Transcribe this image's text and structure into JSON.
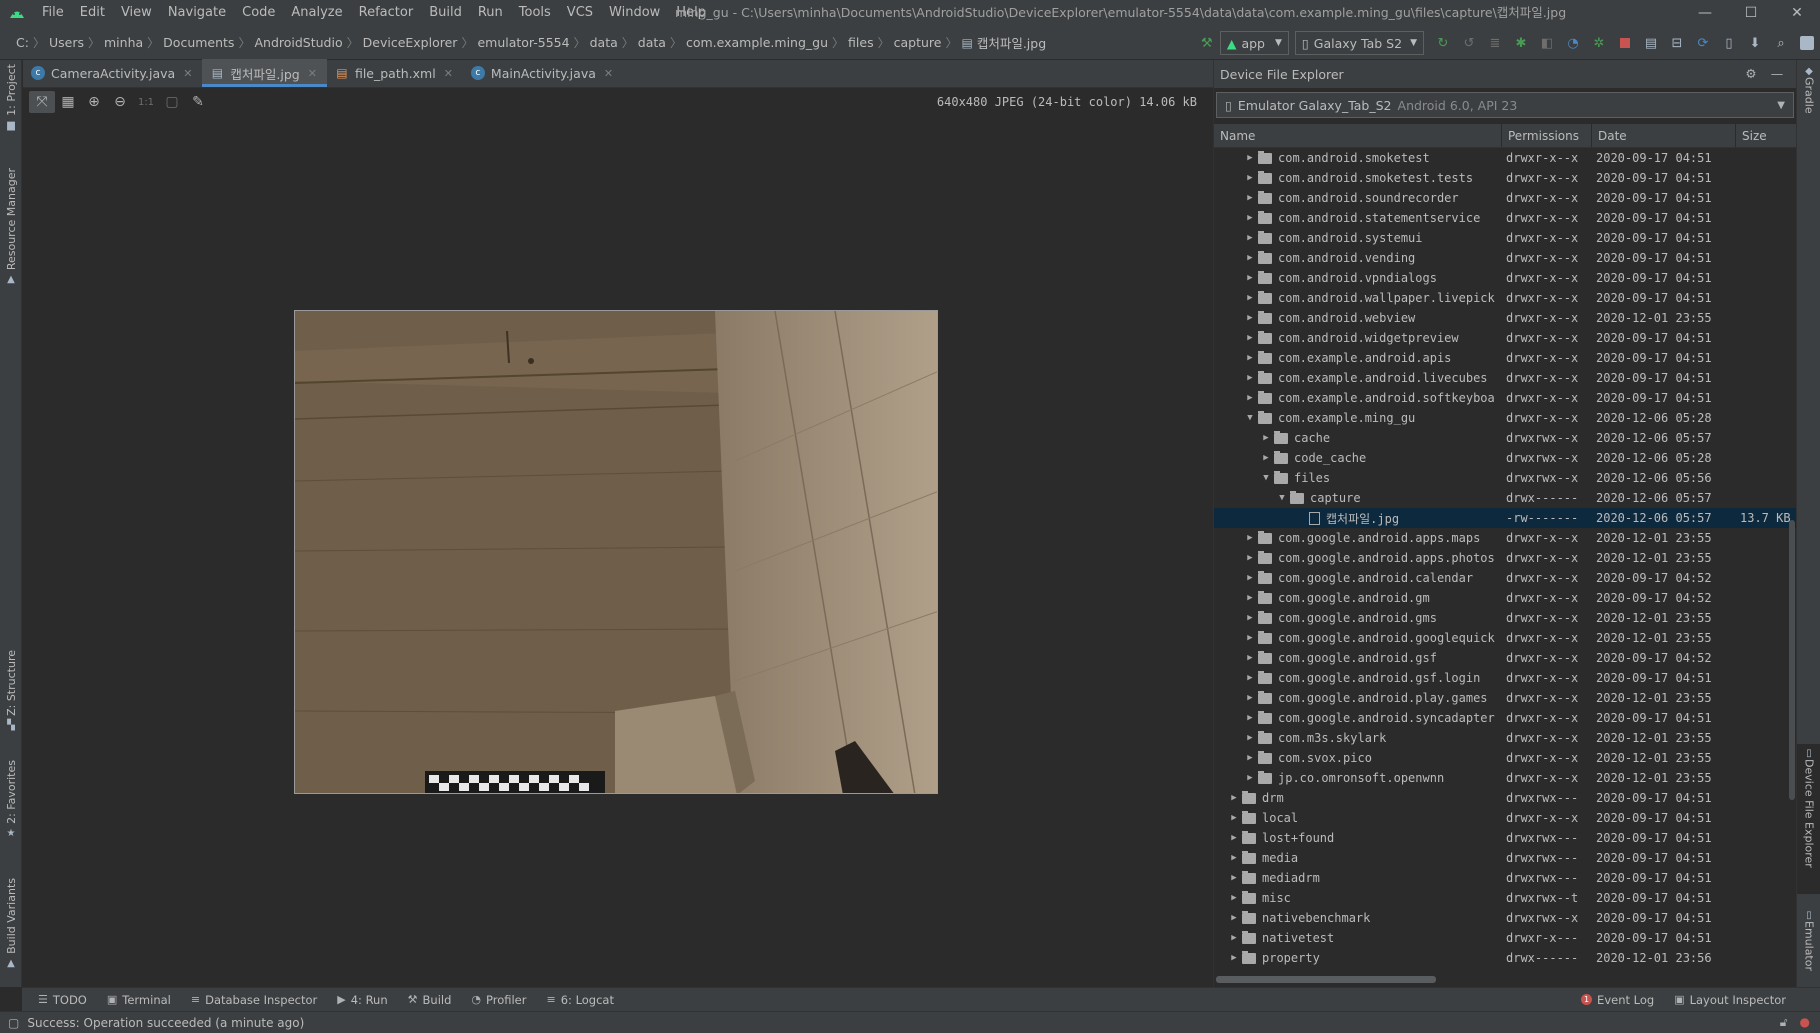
{
  "window": {
    "title": "ming_gu - C:\\Users\\minha\\Documents\\AndroidStudio\\DeviceExplorer\\emulator-5554\\data\\data\\com.example.ming_gu\\files\\capture\\캡처파일.jpg",
    "minimize": "—",
    "maximize": "☐",
    "close": "✕"
  },
  "menu": [
    "File",
    "Edit",
    "View",
    "Navigate",
    "Code",
    "Analyze",
    "Refactor",
    "Build",
    "Run",
    "Tools",
    "VCS",
    "Window",
    "Help"
  ],
  "breadcrumb": [
    "C:",
    "Users",
    "minha",
    "Documents",
    "AndroidStudio",
    "DeviceExplorer",
    "emulator-5554",
    "data",
    "data",
    "com.example.ming_gu",
    "files",
    "capture",
    "캡처파일.jpg"
  ],
  "toolbar": {
    "run_config": "app",
    "device": "Galaxy Tab S2"
  },
  "left_tools": [
    "1: Project",
    "Resource Manager",
    "Z: Structure",
    "2: Favorites",
    "Build Variants"
  ],
  "right_tools": [
    "Gradle",
    "Device File Explorer",
    "Emulator"
  ],
  "tabs": [
    {
      "label": "CameraActivity.java",
      "icon": "C",
      "active": false
    },
    {
      "label": "캡처파일.jpg",
      "icon": "img",
      "active": true
    },
    {
      "label": "file_path.xml",
      "icon": "xml",
      "active": false
    },
    {
      "label": "MainActivity.java",
      "icon": "C",
      "active": false
    }
  ],
  "image_viewer": {
    "info": "640x480 JPEG (24-bit color) 14.06 kB",
    "zoom_1to1": "1:1"
  },
  "device_explorer": {
    "title": "Device File Explorer",
    "device_name": "Emulator Galaxy_Tab_S2",
    "device_sub": "Android 6.0, API 23",
    "columns": [
      "Name",
      "Permissions",
      "Date",
      "Size"
    ],
    "rows": [
      {
        "name": "com.android.smoketest",
        "perm": "drwxr-x--x",
        "date": "2020-09-17 04:51",
        "size": "",
        "level": 2,
        "type": "folder",
        "state": "collapsed"
      },
      {
        "name": "com.android.smoketest.tests",
        "perm": "drwxr-x--x",
        "date": "2020-09-17 04:51",
        "size": "",
        "level": 2,
        "type": "folder",
        "state": "collapsed"
      },
      {
        "name": "com.android.soundrecorder",
        "perm": "drwxr-x--x",
        "date": "2020-09-17 04:51",
        "size": "",
        "level": 2,
        "type": "folder",
        "state": "collapsed"
      },
      {
        "name": "com.android.statementservice",
        "perm": "drwxr-x--x",
        "date": "2020-09-17 04:51",
        "size": "",
        "level": 2,
        "type": "folder",
        "state": "collapsed"
      },
      {
        "name": "com.android.systemui",
        "perm": "drwxr-x--x",
        "date": "2020-09-17 04:51",
        "size": "",
        "level": 2,
        "type": "folder",
        "state": "collapsed"
      },
      {
        "name": "com.android.vending",
        "perm": "drwxr-x--x",
        "date": "2020-09-17 04:51",
        "size": "",
        "level": 2,
        "type": "folder",
        "state": "collapsed"
      },
      {
        "name": "com.android.vpndialogs",
        "perm": "drwxr-x--x",
        "date": "2020-09-17 04:51",
        "size": "",
        "level": 2,
        "type": "folder",
        "state": "collapsed"
      },
      {
        "name": "com.android.wallpaper.livepick",
        "perm": "drwxr-x--x",
        "date": "2020-09-17 04:51",
        "size": "",
        "level": 2,
        "type": "folder",
        "state": "collapsed"
      },
      {
        "name": "com.android.webview",
        "perm": "drwxr-x--x",
        "date": "2020-12-01 23:55",
        "size": "",
        "level": 2,
        "type": "folder",
        "state": "collapsed"
      },
      {
        "name": "com.android.widgetpreview",
        "perm": "drwxr-x--x",
        "date": "2020-09-17 04:51",
        "size": "",
        "level": 2,
        "type": "folder",
        "state": "collapsed"
      },
      {
        "name": "com.example.android.apis",
        "perm": "drwxr-x--x",
        "date": "2020-09-17 04:51",
        "size": "",
        "level": 2,
        "type": "folder",
        "state": "collapsed"
      },
      {
        "name": "com.example.android.livecubes",
        "perm": "drwxr-x--x",
        "date": "2020-09-17 04:51",
        "size": "",
        "level": 2,
        "type": "folder",
        "state": "collapsed"
      },
      {
        "name": "com.example.android.softkeyboa",
        "perm": "drwxr-x--x",
        "date": "2020-09-17 04:51",
        "size": "",
        "level": 2,
        "type": "folder",
        "state": "collapsed"
      },
      {
        "name": "com.example.ming_gu",
        "perm": "drwxr-x--x",
        "date": "2020-12-06 05:28",
        "size": "",
        "level": 2,
        "type": "folder",
        "state": "expanded"
      },
      {
        "name": "cache",
        "perm": "drwxrwx--x",
        "date": "2020-12-06 05:57",
        "size": "",
        "level": 3,
        "type": "folder",
        "state": "collapsed"
      },
      {
        "name": "code_cache",
        "perm": "drwxrwx--x",
        "date": "2020-12-06 05:28",
        "size": "",
        "level": 3,
        "type": "folder",
        "state": "collapsed"
      },
      {
        "name": "files",
        "perm": "drwxrwx--x",
        "date": "2020-12-06 05:56",
        "size": "",
        "level": 3,
        "type": "folder",
        "state": "expanded"
      },
      {
        "name": "capture",
        "perm": "drwx------",
        "date": "2020-12-06 05:57",
        "size": "",
        "level": 4,
        "type": "folder",
        "state": "expanded"
      },
      {
        "name": "캡처파일.jpg",
        "perm": "-rw-------",
        "date": "2020-12-06 05:57",
        "size": "13.7 KB",
        "level": 5,
        "type": "file",
        "state": "none",
        "selected": true
      },
      {
        "name": "com.google.android.apps.maps",
        "perm": "drwxr-x--x",
        "date": "2020-12-01 23:55",
        "size": "",
        "level": 2,
        "type": "folder",
        "state": "collapsed"
      },
      {
        "name": "com.google.android.apps.photos",
        "perm": "drwxr-x--x",
        "date": "2020-12-01 23:55",
        "size": "",
        "level": 2,
        "type": "folder",
        "state": "collapsed"
      },
      {
        "name": "com.google.android.calendar",
        "perm": "drwxr-x--x",
        "date": "2020-09-17 04:52",
        "size": "",
        "level": 2,
        "type": "folder",
        "state": "collapsed"
      },
      {
        "name": "com.google.android.gm",
        "perm": "drwxr-x--x",
        "date": "2020-09-17 04:52",
        "size": "",
        "level": 2,
        "type": "folder",
        "state": "collapsed"
      },
      {
        "name": "com.google.android.gms",
        "perm": "drwxr-x--x",
        "date": "2020-12-01 23:55",
        "size": "",
        "level": 2,
        "type": "folder",
        "state": "collapsed"
      },
      {
        "name": "com.google.android.googlequick",
        "perm": "drwxr-x--x",
        "date": "2020-12-01 23:55",
        "size": "",
        "level": 2,
        "type": "folder",
        "state": "collapsed"
      },
      {
        "name": "com.google.android.gsf",
        "perm": "drwxr-x--x",
        "date": "2020-09-17 04:52",
        "size": "",
        "level": 2,
        "type": "folder",
        "state": "collapsed"
      },
      {
        "name": "com.google.android.gsf.login",
        "perm": "drwxr-x--x",
        "date": "2020-09-17 04:51",
        "size": "",
        "level": 2,
        "type": "folder",
        "state": "collapsed"
      },
      {
        "name": "com.google.android.play.games",
        "perm": "drwxr-x--x",
        "date": "2020-12-01 23:55",
        "size": "",
        "level": 2,
        "type": "folder",
        "state": "collapsed"
      },
      {
        "name": "com.google.android.syncadapter",
        "perm": "drwxr-x--x",
        "date": "2020-09-17 04:51",
        "size": "",
        "level": 2,
        "type": "folder",
        "state": "collapsed"
      },
      {
        "name": "com.m3s.skylark",
        "perm": "drwxr-x--x",
        "date": "2020-12-01 23:55",
        "size": "",
        "level": 2,
        "type": "folder",
        "state": "collapsed"
      },
      {
        "name": "com.svox.pico",
        "perm": "drwxr-x--x",
        "date": "2020-12-01 23:55",
        "size": "",
        "level": 2,
        "type": "folder",
        "state": "collapsed"
      },
      {
        "name": "jp.co.omronsoft.openwnn",
        "perm": "drwxr-x--x",
        "date": "2020-12-01 23:55",
        "size": "",
        "level": 2,
        "type": "folder",
        "state": "collapsed"
      },
      {
        "name": "drm",
        "perm": "drwxrwx---",
        "date": "2020-09-17 04:51",
        "size": "",
        "level": 1,
        "type": "folder",
        "state": "collapsed"
      },
      {
        "name": "local",
        "perm": "drwxr-x--x",
        "date": "2020-09-17 04:51",
        "size": "",
        "level": 1,
        "type": "folder",
        "state": "collapsed"
      },
      {
        "name": "lost+found",
        "perm": "drwxrwx---",
        "date": "2020-09-17 04:51",
        "size": "",
        "level": 1,
        "type": "folder",
        "state": "collapsed"
      },
      {
        "name": "media",
        "perm": "drwxrwx---",
        "date": "2020-09-17 04:51",
        "size": "",
        "level": 1,
        "type": "folder",
        "state": "collapsed"
      },
      {
        "name": "mediadrm",
        "perm": "drwxrwx---",
        "date": "2020-09-17 04:51",
        "size": "",
        "level": 1,
        "type": "folder",
        "state": "collapsed"
      },
      {
        "name": "misc",
        "perm": "drwxrwx--t",
        "date": "2020-09-17 04:51",
        "size": "",
        "level": 1,
        "type": "folder",
        "state": "collapsed"
      },
      {
        "name": "nativebenchmark",
        "perm": "drwxrwx--x",
        "date": "2020-09-17 04:51",
        "size": "",
        "level": 1,
        "type": "folder",
        "state": "collapsed"
      },
      {
        "name": "nativetest",
        "perm": "drwxr-x---",
        "date": "2020-09-17 04:51",
        "size": "",
        "level": 1,
        "type": "folder",
        "state": "collapsed"
      },
      {
        "name": "property",
        "perm": "drwx------",
        "date": "2020-12-01 23:56",
        "size": "",
        "level": 1,
        "type": "folder",
        "state": "collapsed"
      }
    ]
  },
  "bottom_tools": [
    {
      "label": "TODO",
      "icon": "☰"
    },
    {
      "label": "Terminal",
      "icon": "▣"
    },
    {
      "label": "Database Inspector",
      "icon": "≡"
    },
    {
      "label": "4: Run",
      "icon": "▶"
    },
    {
      "label": "Build",
      "icon": "⚒"
    },
    {
      "label": "Profiler",
      "icon": "◔"
    },
    {
      "label": "6: Logcat",
      "icon": "≡"
    }
  ],
  "bottom_right_tools": [
    {
      "label": "Event Log",
      "badge": "1"
    },
    {
      "label": "Layout Inspector",
      "badge": ""
    }
  ],
  "status": {
    "message": "Success: Operation succeeded (a minute ago)"
  },
  "colors": {
    "accent": "#4a88c7",
    "selection": "#0d293e",
    "run_green": "#499c54",
    "stop_red": "#c75450"
  }
}
